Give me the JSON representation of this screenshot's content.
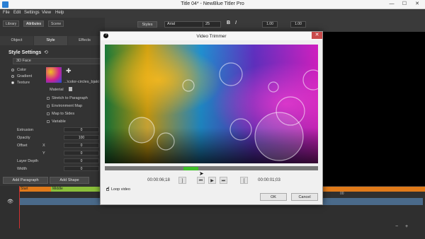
{
  "window": {
    "title": "Title 04* - NewBlue Titler Pro",
    "minimize": "—",
    "maximize": "☐",
    "close": "✕"
  },
  "menu": [
    "File",
    "Edit",
    "Settings",
    "View",
    "Help"
  ],
  "left_tabs": [
    "Library",
    "Attributes",
    "Scene"
  ],
  "sub_tabs": [
    "Object",
    "Style",
    "Effects"
  ],
  "style_settings": {
    "heading": "Style Settings",
    "face_dropdown": "3D Face",
    "fill_options": [
      "Color",
      "Gradient",
      "Texture"
    ],
    "texture_file": "...\\color-circles_bjaki",
    "material_label": "Material",
    "options": [
      "Stretch to Paragraph",
      "Environment Map",
      "Map to Sides",
      "Variable"
    ]
  },
  "properties": [
    {
      "label": "Extrusion",
      "value": "0"
    },
    {
      "label": "Opacity",
      "value": "100"
    },
    {
      "label": "Offset",
      "axis": "X",
      "value": "0"
    },
    {
      "label": "",
      "axis": "Y",
      "value": "0"
    },
    {
      "label": "Layer Depth",
      "value": "0"
    },
    {
      "label": "Width",
      "value": "0"
    }
  ],
  "bottom_buttons": {
    "add_paragraph": "Add Paragraph",
    "add_shape": "Add Shape"
  },
  "toolbar": {
    "styles": "Styles",
    "font": "Arial",
    "size": "25",
    "bold": "B",
    "italic": "I",
    "value1": "1.00",
    "value2": "1.00"
  },
  "timeline": {
    "labels": [
      "Start",
      "Middle"
    ],
    "time_marker": "00"
  },
  "dialog": {
    "title": "Video Trimmer",
    "start_time": "00:00:06;18",
    "end_time": "00:00:01;03",
    "loop_label": "Loop video",
    "ok": "OK",
    "cancel": "Cancel",
    "mark_in": "]",
    "mark_out": "[",
    "prev": "⏮",
    "play": "▶",
    "next": "⏭"
  },
  "trim_selection_fraction": [
    0.37,
    0.44
  ]
}
